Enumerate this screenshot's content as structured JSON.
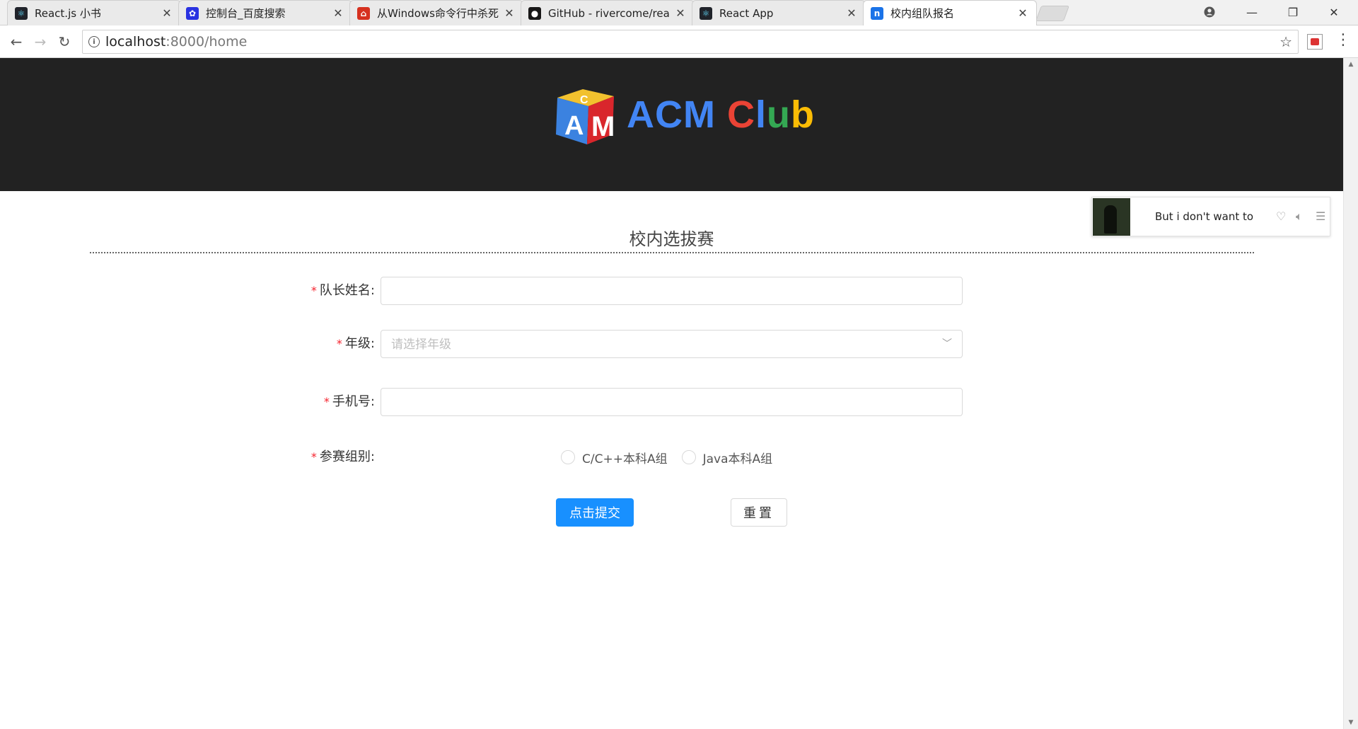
{
  "browser": {
    "tabs": [
      {
        "title": "React.js 小书",
        "favicon_color": "#20232a",
        "glyph": "⚛"
      },
      {
        "title": "控制台_百度搜索",
        "favicon_color": "#2932e1",
        "glyph": "✿"
      },
      {
        "title": "从Windows命令行中杀死",
        "favicon_color": "#d6311f",
        "glyph": "⌂"
      },
      {
        "title": "GitHub - rivercome/rea",
        "favicon_color": "#181717",
        "glyph": "●"
      },
      {
        "title": "React App",
        "favicon_color": "#20232a",
        "glyph": "⚛"
      },
      {
        "title": "校内组队报名",
        "favicon_color": "#1a73e8",
        "glyph": "n"
      }
    ],
    "active_tab": 5,
    "address": {
      "host": "localhost",
      "path": ":8000/home"
    }
  },
  "header": {
    "brand_letters": [
      {
        "char": "A",
        "color": "#4285f4"
      },
      {
        "char": "C",
        "color": "#4285f4"
      },
      {
        "char": "M",
        "color": "#4285f4"
      },
      {
        "char": " ",
        "color": "#ffffff"
      },
      {
        "char": "C",
        "color": "#ea4335"
      },
      {
        "char": "l",
        "color": "#4285f4"
      },
      {
        "char": "u",
        "color": "#34a853"
      },
      {
        "char": "b",
        "color": "#fbbc05"
      }
    ],
    "logo_icon": "acm-cube-icon"
  },
  "form": {
    "title": "校内选拔赛",
    "required_mark": "*",
    "fields": {
      "captain_label": "队长姓名:",
      "captain_value": "",
      "grade_label": "年级:",
      "grade_placeholder": "请选择年级",
      "phone_label": "手机号:",
      "phone_value": "",
      "group_label": "参赛组别:",
      "group_options": [
        "C/C++本科A组",
        "Java本科A组"
      ]
    },
    "submit_label": "点击提交",
    "reset_label": "重置"
  },
  "music_player": {
    "song": "But i don't want to"
  },
  "colors": {
    "primary": "#1890ff",
    "required": "#f5222d",
    "header_bg": "#222222"
  }
}
